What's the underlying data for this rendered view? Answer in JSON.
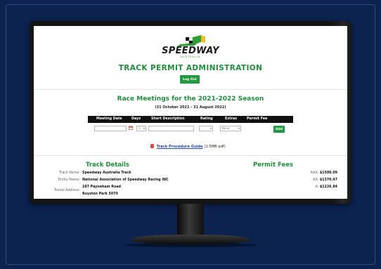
{
  "logo": {
    "text": "SPEEDWAY",
    "subtext": "AUSTRALIA"
  },
  "header": {
    "title": "TRACK PERMIT ADMINISTRATION",
    "logout_label": "Log Out"
  },
  "season": {
    "title": "Race Meetings for the 2021-2022 Season",
    "range": "(31 October 2021 - 31 August 2022)"
  },
  "table": {
    "columns": [
      "Meeting Date",
      "Days",
      "Short Description",
      "Rating",
      "Extras",
      "Permit Fee"
    ],
    "row": {
      "date_value": "",
      "days_value": "1",
      "description_value": "",
      "rating_value": "",
      "extras_value": "None"
    },
    "add_label": "Add"
  },
  "guide": {
    "link_text": "Track Procedure Guide",
    "size_text": "(1.5MB pdf)"
  },
  "track_details": {
    "heading": "Track Details",
    "rows": [
      {
        "label": "Track Name:",
        "value": "Speedway Australia Track"
      },
      {
        "label": "Entity Name:",
        "value": "National Association of Speedway Racing INC"
      },
      {
        "label": "Postal Address:",
        "value": "287 Payneham Road"
      },
      {
        "label": "",
        "value": "Royston Park 5070"
      }
    ]
  },
  "permit_fees": {
    "heading": "Permit Fees",
    "rows": [
      {
        "label": "AAA:",
        "value": "$1500.09"
      },
      {
        "label": "AA:",
        "value": "$1370.47"
      },
      {
        "label": "A:",
        "value": "$1226.84"
      }
    ]
  },
  "colors": {
    "page_background": "#0c2350",
    "accent_green": "#1e8f3a",
    "button_green": "#1f9a3f",
    "table_header": "#111111",
    "link_blue": "#2a47a8"
  }
}
